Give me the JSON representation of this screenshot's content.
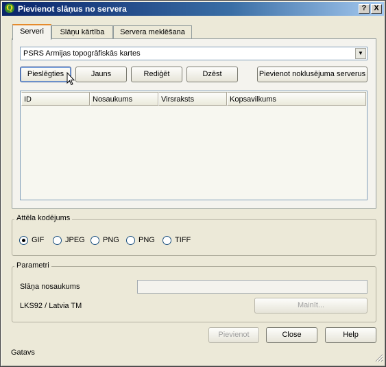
{
  "window": {
    "title": "Pievienot slāņus no servera",
    "help_btn": "?",
    "close_btn": "X"
  },
  "tabs": [
    {
      "label": "Serveri",
      "active": true
    },
    {
      "label": "Slāņu kārtība",
      "active": false
    },
    {
      "label": "Servera meklēšana",
      "active": false
    }
  ],
  "server": {
    "selected": "PSRS Armijas topogrāfiskās kartes",
    "connect_label": "Pieslēgties",
    "new_label": "Jauns",
    "edit_label": "Rediģēt",
    "delete_label": "Dzēst",
    "add_default_label": "Pievienot noklusējuma serverus"
  },
  "table": {
    "columns": [
      "ID",
      "Nosaukums",
      "Virsraksts",
      "Kopsavilkums"
    ],
    "rows": []
  },
  "encoding": {
    "title": "Attēla kodējums",
    "options": [
      {
        "label": "GIF",
        "checked": true
      },
      {
        "label": "JPEG",
        "checked": false
      },
      {
        "label": "PNG",
        "checked": false
      },
      {
        "label": "PNG",
        "checked": false
      },
      {
        "label": "TIFF",
        "checked": false
      }
    ]
  },
  "params": {
    "title": "Parametri",
    "layer_name_label": "Slāņa nosaukums",
    "layer_name_value": "",
    "crs_label": "LKS92 / Latvia TM",
    "change_label": "Mainīt..."
  },
  "footer": {
    "add_label": "Pievienot",
    "close_label": "Close",
    "help_label": "Help",
    "status": "Gatavs"
  }
}
